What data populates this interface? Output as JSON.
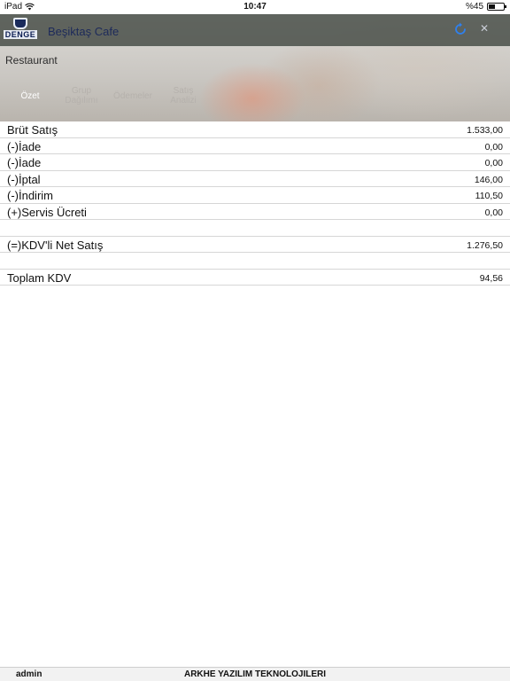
{
  "status_bar": {
    "device": "iPad",
    "time": "10:47",
    "battery_text": "%45",
    "battery_level": 0.45
  },
  "header": {
    "logo_text": "DENGE",
    "title": "Beşiktaş Cafe"
  },
  "section": {
    "label": "Restaurant"
  },
  "tabs": [
    {
      "label": "Özet",
      "active": true
    },
    {
      "label": "Grup Dağılımı",
      "active": false
    },
    {
      "label": "Ödemeler",
      "active": false
    },
    {
      "label": "Satış Analizi",
      "active": false
    }
  ],
  "summary": [
    {
      "label": "Brüt Satış",
      "value": "1.533,00"
    },
    {
      "label": "(-)İade",
      "value": "0,00"
    },
    {
      "label": "(-)İade",
      "value": "0,00"
    },
    {
      "label": "(-)İptal",
      "value": "146,00"
    },
    {
      "label": "(-)İndirim",
      "value": "110,50"
    },
    {
      "label": "(+)Servis Ücreti",
      "value": "0,00"
    }
  ],
  "net_sales": {
    "label": "(=)KDV'li Net Satış",
    "value": "1.276,50"
  },
  "total_vat": {
    "label": "Toplam KDV",
    "value": "94,56"
  },
  "footer": {
    "user": "admin",
    "company": "ARKHE YAZILIM TEKNOLOJILERI"
  },
  "colors": {
    "titlebar": "#3c423c",
    "title_text": "#1d2a5a",
    "refresh_icon": "#2f80ed"
  }
}
